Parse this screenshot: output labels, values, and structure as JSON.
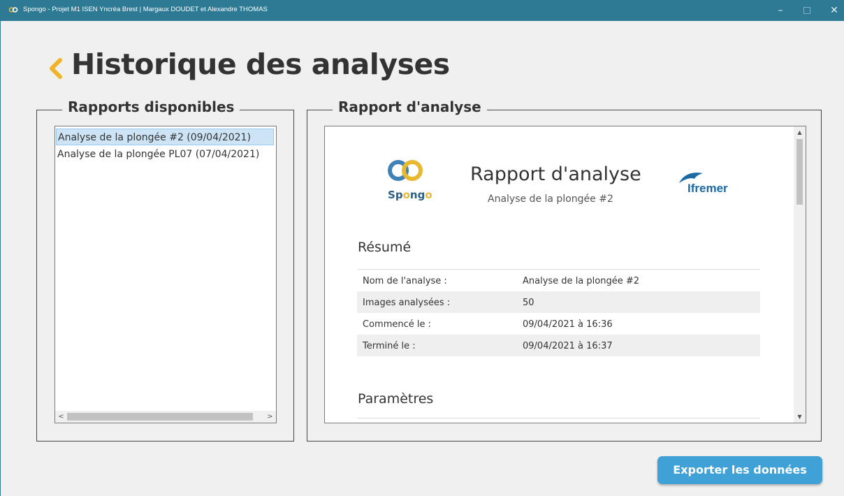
{
  "window": {
    "title": "Spongo - Projet M1 ISEN Yncréa Brest | Margaux DOUDET et Alexandre THOMAS",
    "minimize_glyph": "–",
    "close_glyph": "✕"
  },
  "page": {
    "title": "Historique des analyses",
    "back_icon": "chevron-left-icon",
    "accent_color": "#f0b429"
  },
  "reports_panel": {
    "legend": "Rapports disponibles",
    "items": [
      {
        "label": "Analyse de la plongée #2 (09/04/2021)",
        "selected": true
      },
      {
        "label": "Analyse de la plongée PL07 (07/04/2021)",
        "selected": false
      }
    ],
    "scroll_left": "<",
    "scroll_right": ">"
  },
  "report_panel": {
    "legend": "Rapport d'analyse",
    "report": {
      "logo_left_text": "Spongo",
      "title": "Rapport d'analyse",
      "subtitle": "Analyse de la plongée #2",
      "logo_right_text": "Ifremer",
      "summary_heading": "Résumé",
      "summary_rows": [
        {
          "key": "Nom de l'analyse :",
          "value": "Analyse de la plongée #2"
        },
        {
          "key": "Images analysées :",
          "value": "50"
        },
        {
          "key": "Commencé le :",
          "value": "09/04/2021 à 16:36"
        },
        {
          "key": "Terminé le :",
          "value": "09/04/2021 à 16:37"
        }
      ],
      "params_heading": "Paramètres"
    },
    "scroll_up": "▲",
    "scroll_down": "▼"
  },
  "actions": {
    "export_label": "Exporter les données",
    "export_color": "#3fa1d6"
  }
}
